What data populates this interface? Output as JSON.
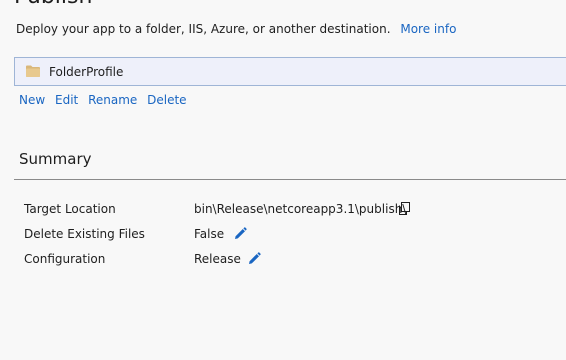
{
  "header": {
    "title": "Publish",
    "description": "Deploy your app to a folder, IIS, Azure, or another destination.",
    "more_info_link": "More info"
  },
  "profile": {
    "name": "FolderProfile",
    "icon": "folder-icon"
  },
  "profile_actions": {
    "new_label": "New",
    "edit_label": "Edit",
    "rename_label": "Rename",
    "delete_label": "Delete"
  },
  "summary": {
    "title": "Summary",
    "rows": [
      {
        "label": "Target Location",
        "value": "bin\\Release\\netcoreapp3.1\\publish\\",
        "action_icon": "copy-icon"
      },
      {
        "label": "Delete Existing Files",
        "value": "False",
        "action_icon": "edit-pencil-icon"
      },
      {
        "label": "Configuration",
        "value": "Release",
        "action_icon": "edit-pencil-icon"
      }
    ]
  },
  "colors": {
    "link": "#1a66c2",
    "profile_background": "#eef0fa",
    "profile_border": "#9fb5d6",
    "pencil_icon": "#1a66c2",
    "folder_icon": "#d9b77a"
  }
}
